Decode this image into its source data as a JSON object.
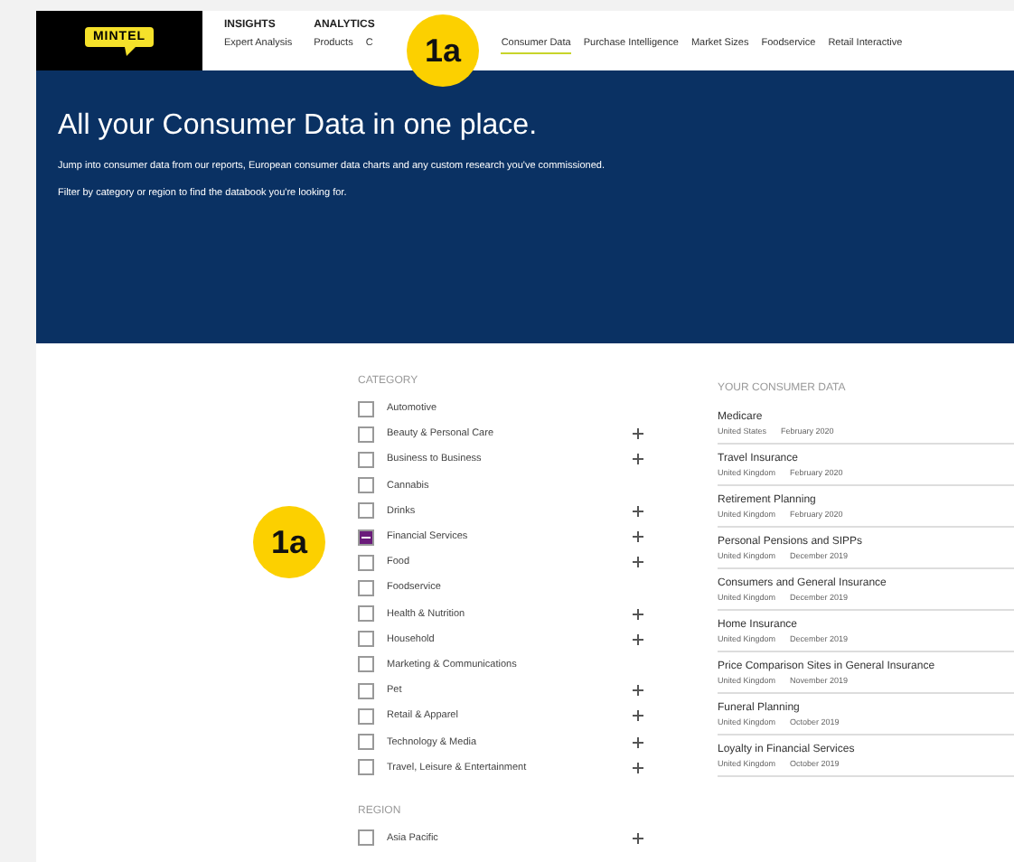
{
  "logo": {
    "text": "MINTEL"
  },
  "nav": [
    {
      "title": "INSIGHTS",
      "items": [
        {
          "label": "Expert Analysis",
          "selected": false
        }
      ]
    },
    {
      "title": "ANALYTICS",
      "items": [
        {
          "label": "Products",
          "selected": false
        },
        {
          "label": "C",
          "selected": false
        },
        {
          "label": "Consumer Data",
          "selected": true
        },
        {
          "label": "Purchase Intelligence",
          "selected": false
        },
        {
          "label": "Market Sizes",
          "selected": false
        },
        {
          "label": "Foodservice",
          "selected": false
        },
        {
          "label": "Retail Interactive",
          "selected": false
        }
      ]
    }
  ],
  "hero": {
    "title": "All your Consumer Data in one place.",
    "paragraphs": [
      "Jump into consumer data from our reports, European consumer data charts and any custom research you've commissioned.",
      "Filter by category or region to find the databook you're looking for."
    ]
  },
  "filters": [
    {
      "heading": "CATEGORY",
      "options": [
        {
          "label": "Automotive",
          "checked": false,
          "expandable": false
        },
        {
          "label": "Beauty & Personal Care",
          "checked": false,
          "expandable": true
        },
        {
          "label": "Business to Business",
          "checked": false,
          "expandable": true
        },
        {
          "label": "Cannabis",
          "checked": false,
          "expandable": false
        },
        {
          "label": "Drinks",
          "checked": false,
          "expandable": true
        },
        {
          "label": "Financial Services",
          "checked": true,
          "expandable": true
        },
        {
          "label": "Food",
          "checked": false,
          "expandable": true
        },
        {
          "label": "Foodservice",
          "checked": false,
          "expandable": false
        },
        {
          "label": "Health & Nutrition",
          "checked": false,
          "expandable": true
        },
        {
          "label": "Household",
          "checked": false,
          "expandable": true
        },
        {
          "label": "Marketing & Communications",
          "checked": false,
          "expandable": false
        },
        {
          "label": "Pet",
          "checked": false,
          "expandable": true
        },
        {
          "label": "Retail & Apparel",
          "checked": false,
          "expandable": true
        },
        {
          "label": "Technology & Media",
          "checked": false,
          "expandable": true
        },
        {
          "label": "Travel, Leisure & Entertainment",
          "checked": false,
          "expandable": true
        }
      ]
    },
    {
      "heading": "REGION",
      "options": [
        {
          "label": "Asia Pacific",
          "checked": false,
          "expandable": true
        }
      ]
    }
  ],
  "consumer_data": {
    "heading": "YOUR CONSUMER DATA",
    "items": [
      {
        "title": "Medicare",
        "region": "United States",
        "date": "February 2020"
      },
      {
        "title": "Travel Insurance",
        "region": "United Kingdom",
        "date": "February 2020"
      },
      {
        "title": "Retirement Planning",
        "region": "United Kingdom",
        "date": "February 2020"
      },
      {
        "title": "Personal Pensions and SIPPs",
        "region": "United Kingdom",
        "date": "December 2019"
      },
      {
        "title": "Consumers and General Insurance",
        "region": "United Kingdom",
        "date": "December 2019"
      },
      {
        "title": "Home Insurance",
        "region": "United Kingdom",
        "date": "December 2019"
      },
      {
        "title": "Price Comparison Sites in General Insurance",
        "region": "United Kingdom",
        "date": "November 2019"
      },
      {
        "title": "Funeral Planning",
        "region": "United Kingdom",
        "date": "October 2019"
      },
      {
        "title": "Loyalty in Financial Services",
        "region": "United Kingdom",
        "date": "October 2019"
      }
    ]
  },
  "badges": [
    {
      "label": "1a"
    },
    {
      "label": "1a"
    }
  ]
}
